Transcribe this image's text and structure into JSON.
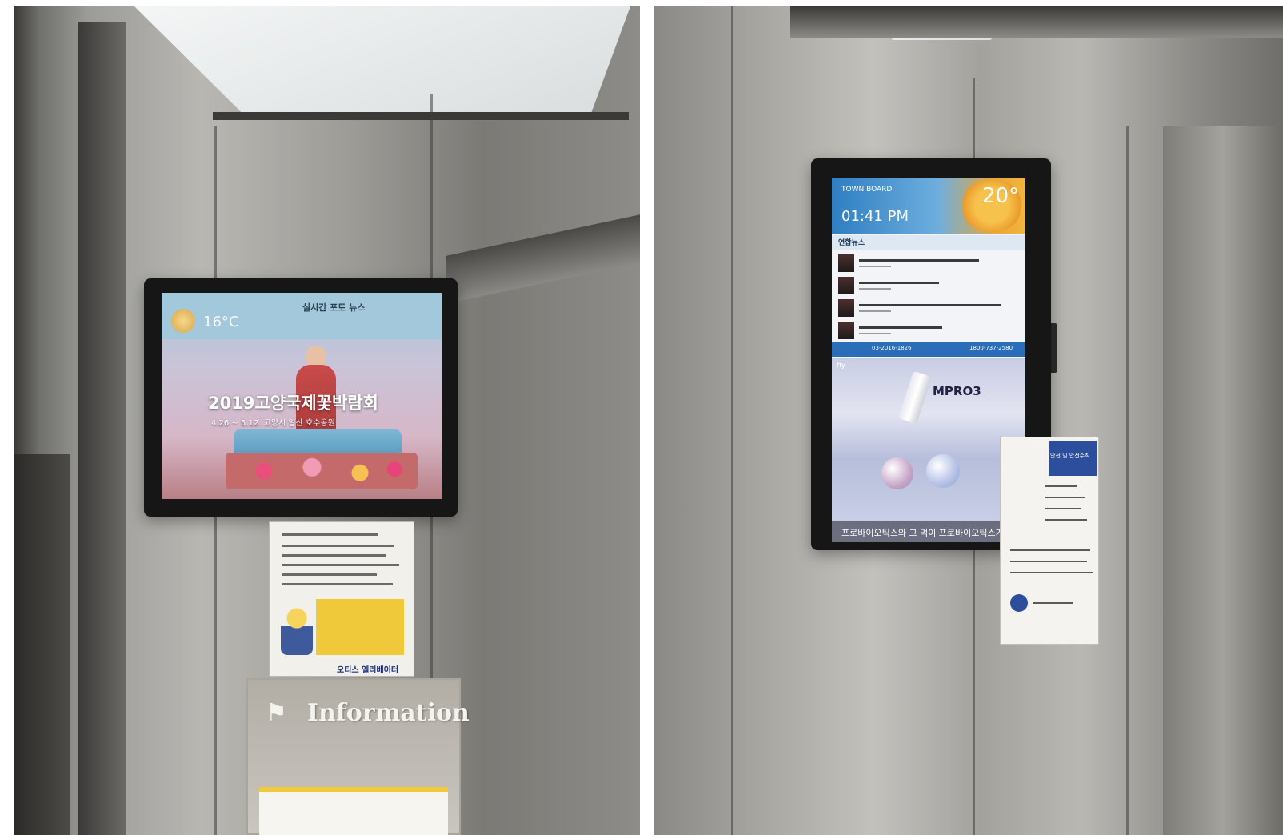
{
  "left_photo": {
    "screen": {
      "news_label": "실시간 포토 뉴스",
      "temperature": "16°C",
      "event_title": "2019고양국제꽃박람회",
      "event_subtitle": "4.26 ~ 5.12. 고양시 일산 호수공원"
    },
    "notice_brand": "오티스 엘리베이터",
    "info_board_label": "Information"
  },
  "right_photo": {
    "screen": {
      "brand": "TOWN BOARD",
      "time": "01:41 PM",
      "temperature": "20°",
      "news_header": "연합뉴스",
      "phone_left": "03-2016-1826",
      "phone_right": "1800-737-2580",
      "ad_product": "MPRO3",
      "ad_caption": "프로바이오틱스와 그 먹이 프로바이오틱스가 만나"
    },
    "safety_card_title": "안전 및 안전수칙"
  }
}
